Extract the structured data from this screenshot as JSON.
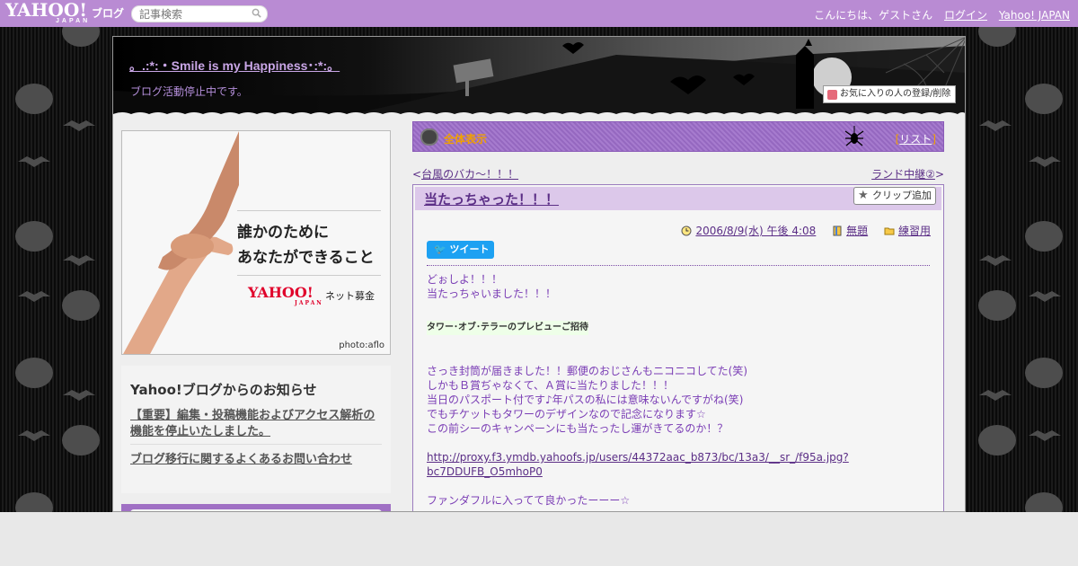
{
  "topbar": {
    "logo": "YAHOO!",
    "logo_sub": "JAPAN",
    "service": "ブログ",
    "search_placeholder": "記事検索",
    "greeting": "こんにちは、ゲストさん",
    "login": "ログイン",
    "yahoo_japan": "Yahoo! JAPAN"
  },
  "header": {
    "blog_title": "。.:*:・Smile is my Happiness･:*:。",
    "blog_subtitle": "ブログ活動停止中です。",
    "favorite_button": "お気に入りの人の登録/削除"
  },
  "ad": {
    "line1": "誰かのために",
    "line2": "あなたができること",
    "brand": "YAHOO!",
    "brand_sub": "JAPAN",
    "brand_service": "ネット募金",
    "credit": "photo:aflo"
  },
  "notice": {
    "heading": "Yahoo!ブログからのお知らせ",
    "links": [
      "【重要】編集・投稿機能およびアクセス解析の機能を停止いたしました。",
      "ブログ移行に関するよくあるお問い合わせ"
    ]
  },
  "category_bar": {
    "label": "全体表示",
    "list_open": "[",
    "list_link": "リスト",
    "list_close": "]"
  },
  "nav": {
    "prev_arrow": "<",
    "prev_label": "台風のバカ～！！！",
    "next_label": "ランド中継②",
    "next_arrow": ">"
  },
  "article": {
    "title": "当たっちゃった！！！",
    "clip_button": "クリップ追加",
    "date": "2006/8/9(水) 午後 4:08",
    "theme": "無題",
    "category": "練習用",
    "tweet": "ツイート",
    "lines": [
      "どぉしよ！！！",
      "当たっちゃいました！！！",
      "",
      "",
      "タワー･オブ･テラーのプレビューご招待",
      "",
      "",
      "さっき封筒が届きました！！郵便のおじさんもニコニコしてた(笑)",
      "しかもＢ賞ぢゃなくて、Ａ賞に当たりました！！！",
      "当日のパスポート付です♪年パスの私には意味ないんですがね(笑)",
      "でもチケットもタワーのデザインなので記念になります☆",
      "この前シーのキャンペーンにも当たったし運がきてるのか！？",
      "",
      "http://proxy.f3.ymdb.yahoofs.jp/users/44372aac_b873/bc/13a3/__sr_/f95a.jpg?bc7DDUFB_O5mhoP0",
      "",
      "ファンダフルに入ってて良かったーーー☆"
    ]
  },
  "colors": {
    "topbar": "#b98bd3",
    "accent_purple": "#7a3db5",
    "category_label": "#f0a000"
  },
  "icons": [
    "search-icon",
    "heart-icon",
    "pumpkin-icon",
    "spider-icon",
    "star-icon",
    "clock-icon",
    "book-icon",
    "folder-icon",
    "twitter-bird-icon"
  ]
}
